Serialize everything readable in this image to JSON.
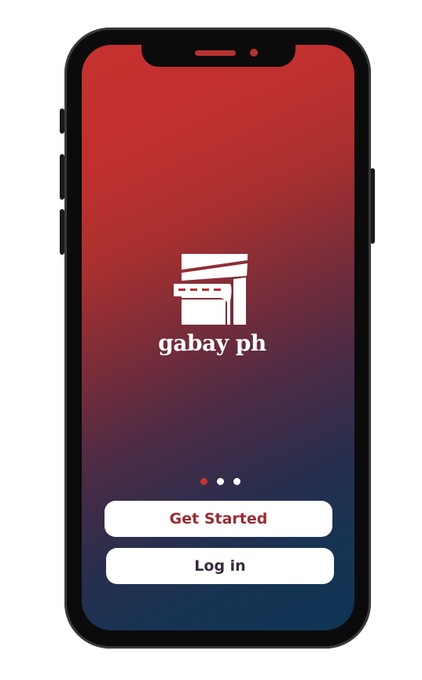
{
  "app": {
    "brand_name": "gabay ph"
  },
  "pager": {
    "total": 3,
    "active_index": 0
  },
  "actions": {
    "get_started_label": "Get Started",
    "login_label": "Log in"
  },
  "colors": {
    "gradient_top": "#c5312f",
    "gradient_bottom": "#0f3555",
    "accent": "#c7332f",
    "button_bg": "#ffffff",
    "get_started_text": "#9a2b33",
    "login_text": "#3a2a3f"
  },
  "icons": {
    "logo": "road-building-logo-icon"
  }
}
